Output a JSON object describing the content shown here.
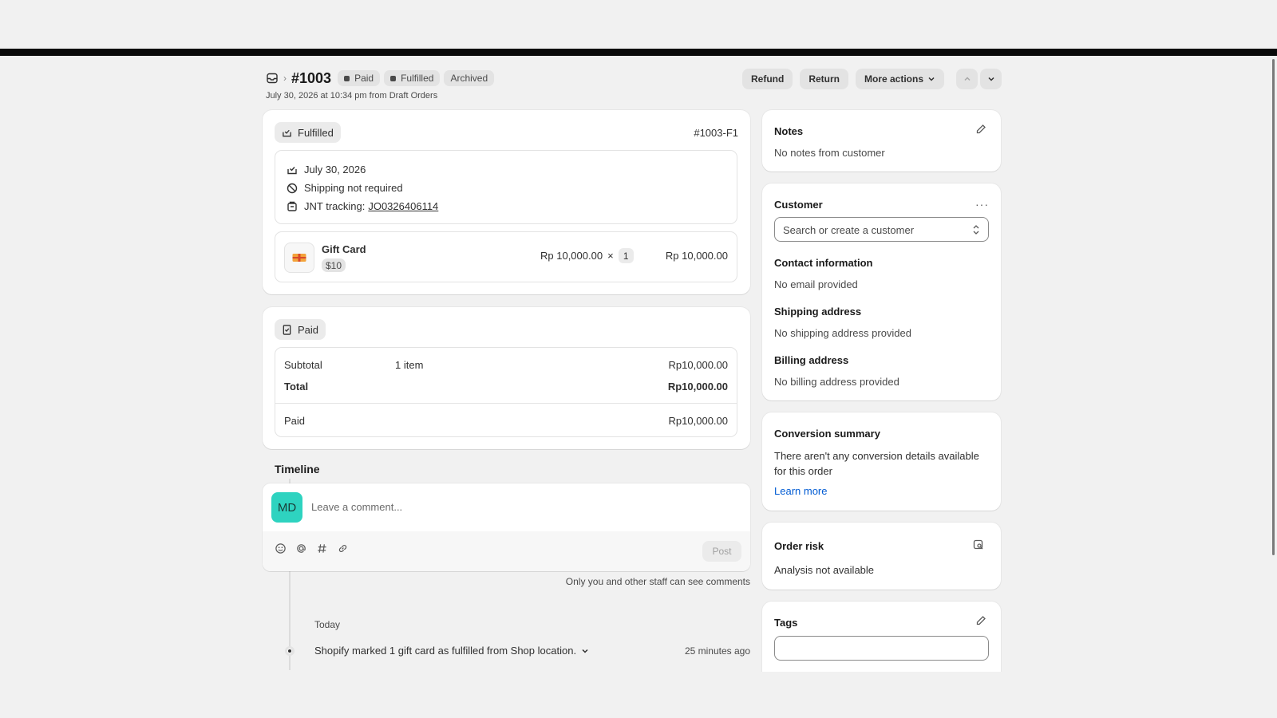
{
  "header": {
    "order_number": "#1003",
    "badges": [
      {
        "label": "Paid",
        "dot": true
      },
      {
        "label": "Fulfilled",
        "dot": true
      },
      {
        "label": "Archived",
        "dot": false
      }
    ],
    "subtitle": "July 30, 2026 at 10:34 pm from Draft Orders",
    "actions": {
      "refund": "Refund",
      "return": "Return",
      "more": "More actions"
    }
  },
  "fulfillment": {
    "status": "Fulfilled",
    "id": "#1003-F1",
    "date": "July 30, 2026",
    "shipping": "Shipping not required",
    "tracking_label": "JNT tracking:",
    "tracking_number": "JO0326406114",
    "item": {
      "name": "Gift Card",
      "variant": "$10",
      "unit_price": "Rp 10,000.00",
      "times": "×",
      "qty": "1",
      "total": "Rp 10,000.00"
    }
  },
  "payment": {
    "status": "Paid",
    "subtotal_label": "Subtotal",
    "subtotal_items": "1 item",
    "subtotal_value": "Rp10,000.00",
    "total_label": "Total",
    "total_value": "Rp10,000.00",
    "paid_label": "Paid",
    "paid_value": "Rp10,000.00"
  },
  "timeline": {
    "title": "Timeline",
    "avatar_initials": "MD",
    "comment_placeholder": "Leave a comment...",
    "post_label": "Post",
    "staff_note": "Only you and other staff can see comments",
    "day_label": "Today",
    "event_text": "Shopify marked 1 gift card as fulfilled from Shop location.",
    "event_time": "25 minutes ago"
  },
  "sidebar": {
    "notes": {
      "title": "Notes",
      "text": "No notes from customer"
    },
    "customer": {
      "title": "Customer",
      "search_placeholder": "Search or create a customer",
      "contact_title": "Contact information",
      "contact_text": "No email provided",
      "shipping_title": "Shipping address",
      "shipping_text": "No shipping address provided",
      "billing_title": "Billing address",
      "billing_text": "No billing address provided"
    },
    "conversion": {
      "title": "Conversion summary",
      "text": "There aren't any conversion details available for this order",
      "link": "Learn more"
    },
    "risk": {
      "title": "Order risk",
      "text": "Analysis not available"
    },
    "tags": {
      "title": "Tags",
      "value": ""
    }
  },
  "colors": {
    "avatar": "#2ed3c0",
    "link": "#005bd3",
    "background": "#f1f1f1"
  }
}
